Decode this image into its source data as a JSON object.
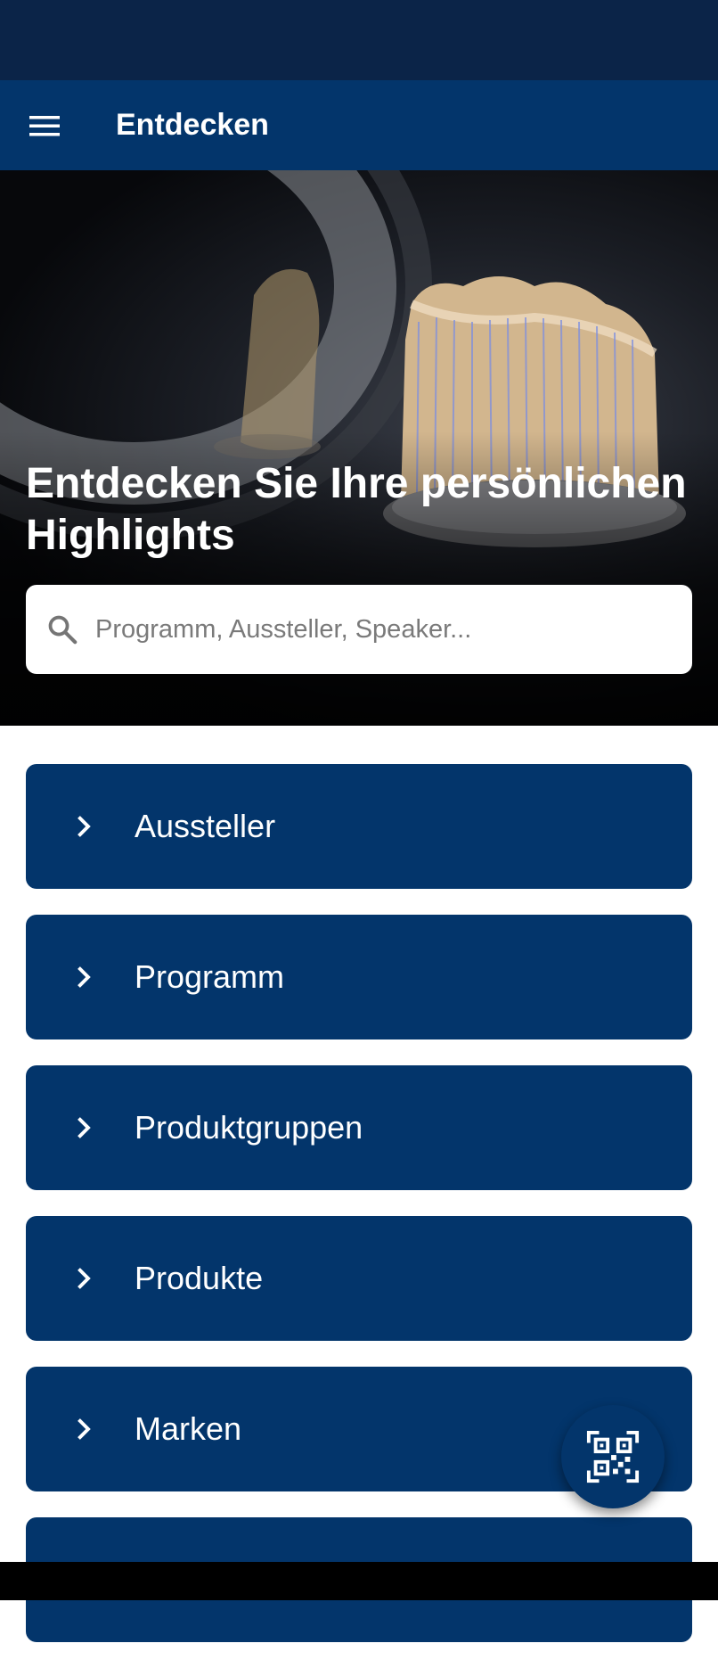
{
  "app_bar": {
    "title": "Entdecken",
    "menu_icon": "hamburger-menu-icon"
  },
  "hero": {
    "title": "Entdecken Sie Ihre persönlichen Highlights",
    "image": "dental-model-scanner-photo"
  },
  "search": {
    "placeholder": "Programm, Aussteller, Speaker...",
    "value": "",
    "icon": "search-icon"
  },
  "menu_items": [
    {
      "label": "Aussteller",
      "icon": "chevron-right-icon"
    },
    {
      "label": "Programm",
      "icon": "chevron-right-icon"
    },
    {
      "label": "Produktgruppen",
      "icon": "chevron-right-icon"
    },
    {
      "label": "Produkte",
      "icon": "chevron-right-icon"
    },
    {
      "label": "Marken",
      "icon": "chevron-right-icon"
    },
    {
      "label": "",
      "icon": "chevron-right-icon"
    }
  ],
  "fab": {
    "icon": "qr-code-icon"
  },
  "colors": {
    "status_bar": "#0b2448",
    "primary": "#03356b",
    "background": "#ffffff",
    "nav_bar": "#000000"
  }
}
